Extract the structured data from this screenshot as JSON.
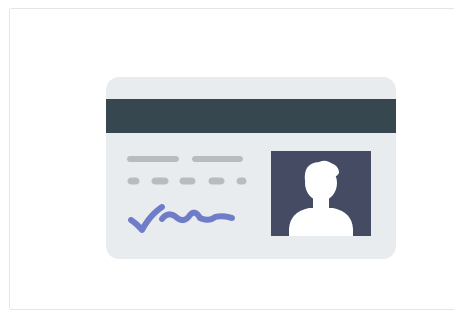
{
  "illustration": {
    "icon": "id-card-icon",
    "colors": {
      "card_background": "#e8ecee",
      "magnetic_stripe": "#37474f",
      "text_placeholder": "#b7bcc0",
      "photo_background": "#444b63",
      "person_silhouette": "#ffffff",
      "signature": "#6f7cc8"
    }
  }
}
